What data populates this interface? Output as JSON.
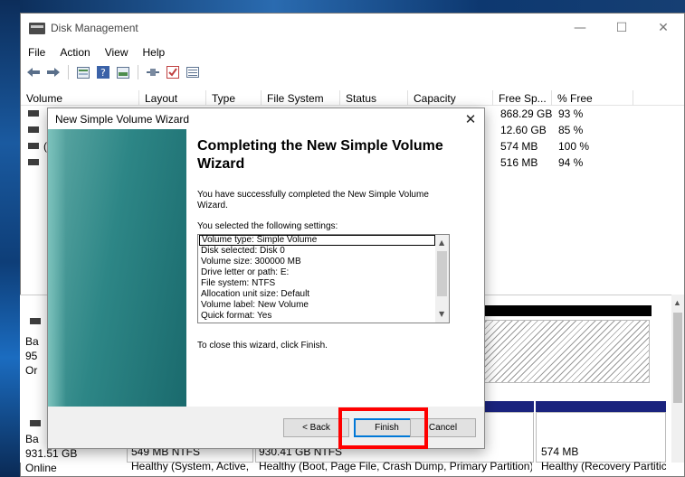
{
  "window": {
    "title": "Disk Management",
    "minimize": "—",
    "maximize": "☐",
    "close": "✕"
  },
  "menu": [
    "File",
    "Action",
    "View",
    "Help"
  ],
  "toolbar": {
    "icons": [
      "back-arrow-icon",
      "forward-arrow-icon",
      "properties-icon",
      "help-icon",
      "console-icon",
      "connect-icon",
      "check-icon",
      "list-icon"
    ]
  },
  "volume_table": {
    "headers": [
      "Volume",
      "Layout",
      "Type",
      "File System",
      "Status",
      "Capacity",
      "Free Sp...",
      "% Free"
    ],
    "rows": [
      {
        "free": "868.29 GB",
        "pct": "93 %"
      },
      {
        "free": "12.60 GB",
        "pct": "85 %"
      },
      {
        "free": "574 MB",
        "pct": "100 %"
      },
      {
        "free": "516 MB",
        "pct": "94 %"
      }
    ],
    "partial_volume_char": "("
  },
  "disks": {
    "disk1": {
      "l1": "Ba",
      "l2": "95",
      "l3": "Or"
    },
    "disk0": {
      "l1": "Ba",
      "l2": "931.51 GB",
      "l3": "Online"
    },
    "partitions": [
      {
        "size": "549 MB NTFS",
        "status": "Healthy (System, Active,"
      },
      {
        "size": "930.41 GB NTFS",
        "status": "Healthy (Boot, Page File, Crash Dump, Primary Partition)"
      },
      {
        "size": "574 MB",
        "status": "Healthy (Recovery Partitic"
      }
    ]
  },
  "wizard": {
    "title": "New Simple Volume Wizard",
    "close": "✕",
    "heading": "Completing the New Simple Volume Wizard",
    "success_text": "You have successfully completed the New Simple Volume Wizard.",
    "settings_intro": "You selected the following settings:",
    "settings": [
      "Volume type: Simple Volume",
      "Disk selected: Disk 0",
      "Volume size: 300000 MB",
      "Drive letter or path: E:",
      "File system: NTFS",
      "Allocation unit size: Default",
      "Volume label: New Volume",
      "Quick format: Yes"
    ],
    "close_instruction": "To close this wizard, click Finish.",
    "buttons": {
      "back": "< Back",
      "finish": "Finish",
      "cancel": "Cancel"
    }
  },
  "colors": {
    "primary_partition": "#1a237e",
    "highlight": "#ff0000",
    "banner": "#2d8686"
  }
}
